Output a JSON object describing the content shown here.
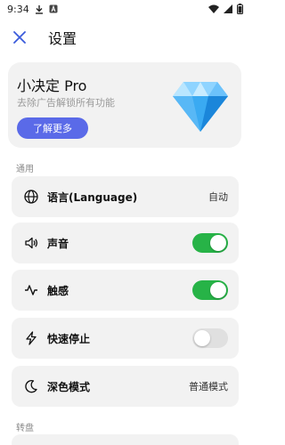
{
  "status_bar": {
    "time": "9:34"
  },
  "app_bar": {
    "title": "设置"
  },
  "pro_card": {
    "title": "小决定 Pro",
    "subtitle": "去除广告解锁所有功能",
    "button_label": "了解更多"
  },
  "sections": {
    "general": "通用",
    "wheel": "转盘"
  },
  "settings": {
    "language": {
      "label": "语言(Language)",
      "value": "自动",
      "icon": "globe-icon"
    },
    "sound": {
      "label": "声音",
      "enabled": true,
      "icon": "speaker-icon"
    },
    "haptics": {
      "label": "触感",
      "enabled": true,
      "icon": "pulse-icon"
    },
    "quick_stop": {
      "label": "快速停止",
      "enabled": false,
      "icon": "bolt-icon"
    },
    "dark_mode": {
      "label": "深色模式",
      "value": "普通模式",
      "icon": "moon-icon"
    }
  },
  "colors": {
    "accent": "#5a6ae8",
    "toggle_on": "#27b347",
    "toggle_off": "#e0e0e0",
    "card_bg": "#f2f2f2",
    "close_icon": "#3b5bdb"
  }
}
